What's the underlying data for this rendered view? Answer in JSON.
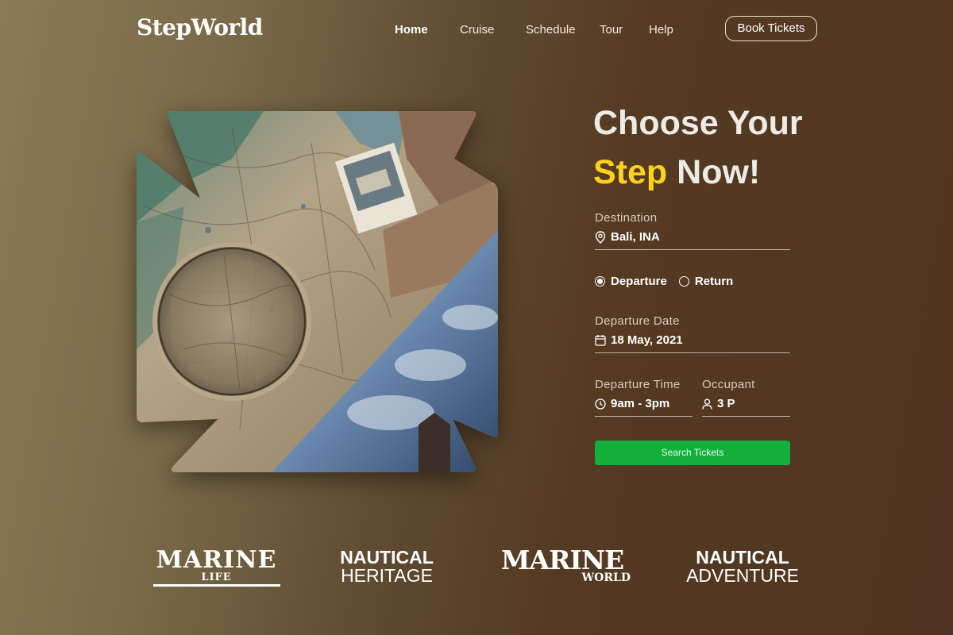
{
  "nav": {
    "logo": "StepWorld",
    "links": [
      "Home",
      "Cruise",
      "Schedule",
      "Tour",
      "Help"
    ],
    "active_link": "Home",
    "book_button": "Book Tickets"
  },
  "hero": {
    "headline_line1": "Choose Your",
    "headline_accent": "Step",
    "headline_line2_rest": " Now!",
    "accent_color": "#ffd21a"
  },
  "form": {
    "destination": {
      "label": "Destination",
      "value": "Bali, INA",
      "icon": "location-pin-icon"
    },
    "trip_type": {
      "options": [
        "Departure",
        "Return"
      ],
      "selected": "Departure"
    },
    "departure_date": {
      "label": "Departure Date",
      "value": "18 May, 2021",
      "icon": "calendar-icon"
    },
    "departure_time": {
      "label": "Departure Time",
      "value": "9am - 3pm",
      "icon": "clock-icon"
    },
    "occupant": {
      "label": "Occupant",
      "value": "3 P",
      "icon": "person-icon"
    },
    "search_button": "Search Tickets",
    "search_button_color": "#12b03a"
  },
  "brands": [
    {
      "line1": "MARINE",
      "line2": "LIFE"
    },
    {
      "line1": "NAUTICAL",
      "line2": "HERITAGE"
    },
    {
      "line1": "MARINE",
      "line2": "WORLD"
    },
    {
      "line1": "NAUTICAL",
      "line2": "ADVENTURE"
    }
  ]
}
